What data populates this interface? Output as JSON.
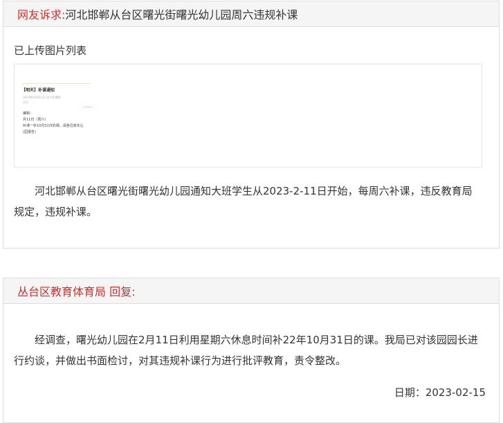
{
  "complaint": {
    "tag": "网友诉求:",
    "title": "河北邯郸从台区曙光街曙光幼儿园周六违规补课",
    "image_section_label": "已上传图片列表",
    "attachment": {
      "title": "【明天】补课通知",
      "meta": "2023年03月11日 10:58 提取",
      "author": "天天",
      "body_lines": [
        "编辑：",
        "月11日（周六）",
        "补课一补10月31日的课。请各位家长让",
        "(园报告)"
      ]
    },
    "body": "河北邯郸从台区曙光街曙光幼儿园通知大班学生从2023-2-11日开始，每周六补课，违反教育局规定，违规补课。"
  },
  "reply": {
    "header": "丛台区教育体育局 回复:",
    "body": "经调查，曙光幼儿园在2月11日利用星期六休息时间补22年10月31日的课。我局已对该园园长进行约谈，并做出书面检讨，对其违规补课行为进行批评教育，责令整改。",
    "date": "日期：2023-02-15"
  },
  "colors": {
    "accent_red": "#c9302c",
    "header_bg": "#f5f5f5",
    "border": "#dddddd"
  }
}
